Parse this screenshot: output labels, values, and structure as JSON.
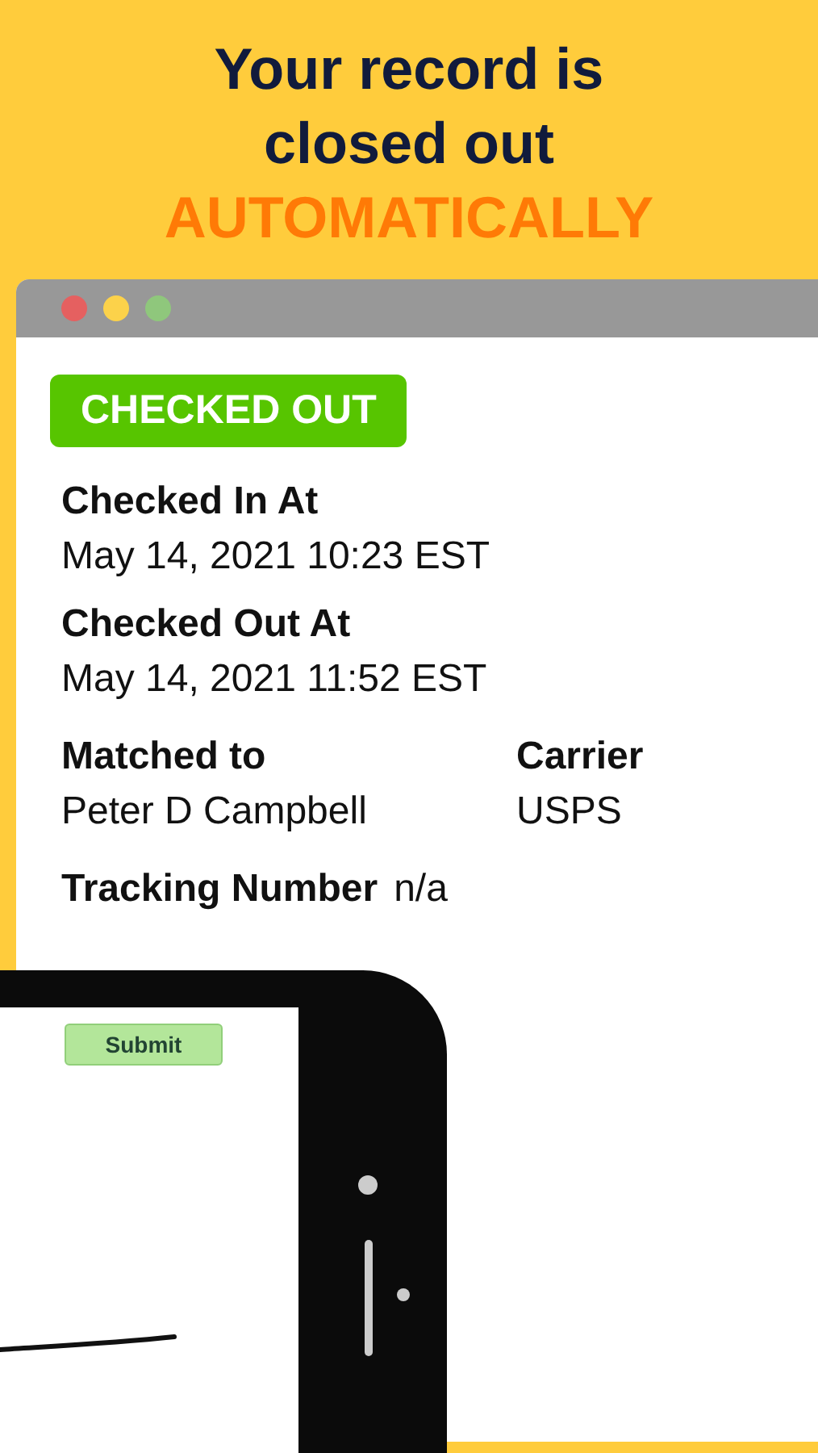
{
  "headline": {
    "lines": [
      {
        "text": "Your record is",
        "kind": "plain"
      },
      {
        "text": "closed out",
        "kind": "plain"
      },
      {
        "text": "AUTOMATICALLY",
        "kind": "accent"
      }
    ]
  },
  "record": {
    "status": "CHECKED OUT",
    "fields": [
      {
        "kind": "stacked",
        "label": "Checked In At",
        "value": "May 14, 2021 10:23 EST"
      },
      {
        "kind": "stacked",
        "label": "Checked Out At",
        "value": "May 14, 2021 11:52 EST"
      },
      {
        "kind": "pair",
        "items": [
          {
            "label": "Matched to",
            "value": "Peter D Campbell"
          },
          {
            "label": "Carrier",
            "value": "USPS"
          }
        ]
      },
      {
        "kind": "inline",
        "label": "Tracking Number",
        "value": "n/a"
      }
    ]
  },
  "phone": {
    "button": "Submit"
  }
}
